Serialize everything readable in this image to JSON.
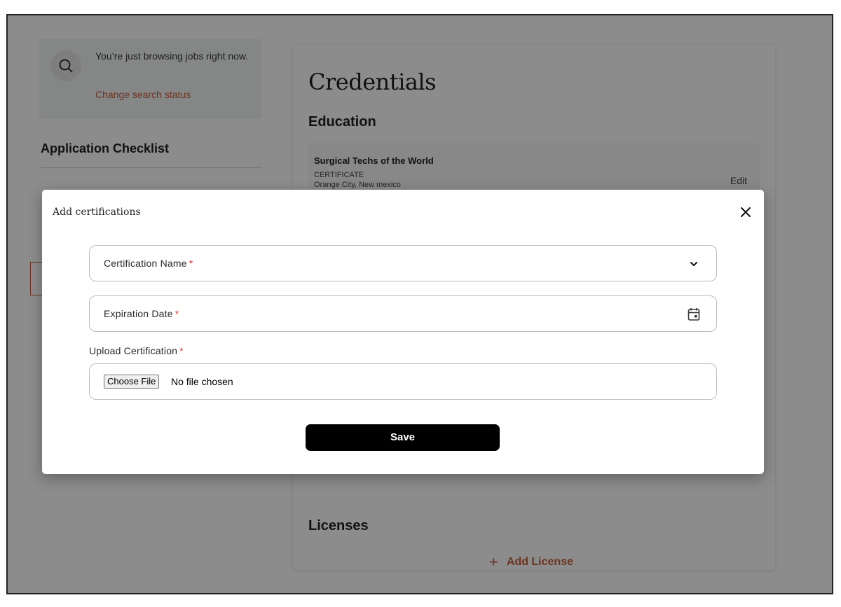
{
  "sidebar": {
    "status_text": "You’re just browsing jobs right now.",
    "status_link": "Change search status",
    "checklist_title": "Application Checklist"
  },
  "main": {
    "title": "Credentials",
    "education_title": "Education",
    "education_items": [
      {
        "name": "Surgical Techs of the World",
        "type": "CERTIFICATE",
        "location": "Orange City, New mexico",
        "edit_label": "Edit"
      }
    ],
    "licenses_title": "Licenses",
    "add_license_icon": "+",
    "add_license_label": "Add License"
  },
  "modal": {
    "title": "Add certifications",
    "certification_name_label": "Certification Name",
    "expiration_date_label": "Expiration Date",
    "upload_label": "Upload Certification",
    "required_mark": "*",
    "choose_file_label": "Choose File",
    "file_status": "No file chosen",
    "save_label": "Save"
  },
  "icons": {
    "search": "search-icon",
    "close": "close-icon",
    "dropdown": "chevron-down-icon",
    "calendar": "calendar-icon"
  },
  "colors": {
    "accent": "#c7603f",
    "required": "#e53935",
    "primary_button": "#000000",
    "overlay": "rgba(0,0,0,0.45)"
  }
}
